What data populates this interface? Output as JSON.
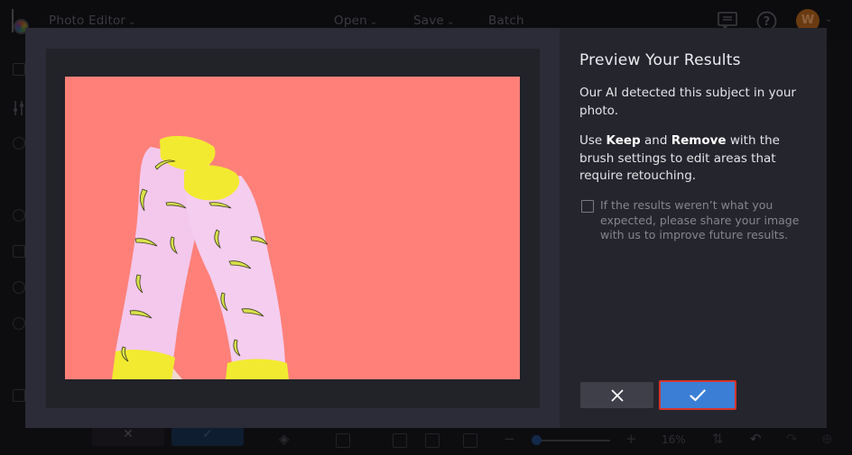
{
  "app": {
    "title": "Photo Editor",
    "menu": [
      {
        "label": "Open"
      },
      {
        "label": "Save"
      },
      {
        "label": "Batch"
      }
    ],
    "avatar_initial": "W"
  },
  "bottom_toolbar": {
    "zoom_level": "16%",
    "zoom_slider_fraction": 0.0
  },
  "dialog": {
    "title": "Preview Your Results",
    "intro": "Our AI detected this subject in your photo.",
    "instructions": {
      "prefix": "Use ",
      "keep": "Keep",
      "middle": " and ",
      "remove": "Remove",
      "suffix": " with the brush settings to edit areas that require retouching."
    },
    "feedback_checkbox": {
      "checked": false,
      "label": "If the results weren’t what you expected, please share your image with us to improve future results."
    },
    "preview_image": {
      "description": "Pink socks with banana pattern and yellow toes/cuffs on coral background",
      "background_color": "#fe8079"
    },
    "cancel_icon": "close-icon",
    "confirm_icon": "check-icon"
  },
  "colors": {
    "accent": "#3a7fd5",
    "focus_outline": "#d6342a",
    "modal_bg": "#2c2b38",
    "side_bg": "#25252d"
  }
}
